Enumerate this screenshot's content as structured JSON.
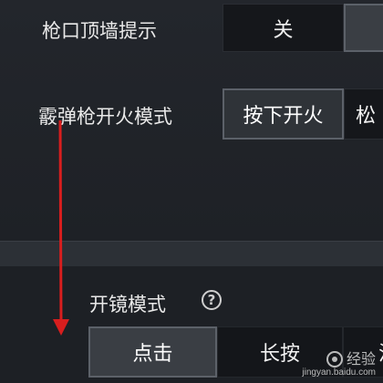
{
  "settings": {
    "muzzle_wall_hint": {
      "label": "枪口顶墙提示",
      "options": [
        "关",
        ""
      ]
    },
    "shotgun_fire_mode": {
      "label": "霰弹枪开火模式",
      "options": [
        "按下开火",
        "松"
      ]
    },
    "scope_mode": {
      "label": "开镜模式",
      "help": "?",
      "options": [
        "点击",
        "长按",
        "混"
      ]
    }
  },
  "annotation": {
    "color": "#d81e1e"
  },
  "watermark": {
    "main": "经验",
    "sub": "jingyan.baidu.com"
  }
}
